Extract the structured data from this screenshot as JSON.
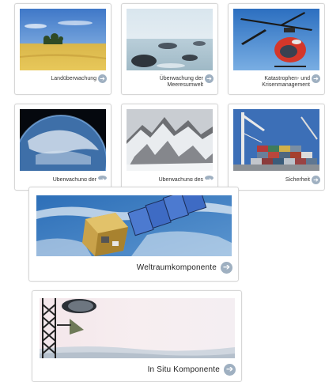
{
  "tiles": [
    {
      "label": "Landüberwachung",
      "thumb": "field-landscape"
    },
    {
      "label_line1": "Überwachung der",
      "label_line2": "Meeresumwelt",
      "thumb": "sea-rocks"
    },
    {
      "label_line1": "Katastrophen- und",
      "label_line2": "Krisenmanagement",
      "thumb": "rescue-helicopter"
    },
    {
      "label": "Überwachung der",
      "thumb": "earth-atmosphere"
    },
    {
      "label": "Überwachung des",
      "thumb": "snowy-mountains"
    },
    {
      "label": "Sicherheit",
      "thumb": "container-port"
    },
    {
      "label": "Weltraumkomponente",
      "thumb": "satellite"
    },
    {
      "label": "In Situ Komponente",
      "thumb": "measurement-mast"
    }
  ],
  "arrow_glyph": "➔"
}
